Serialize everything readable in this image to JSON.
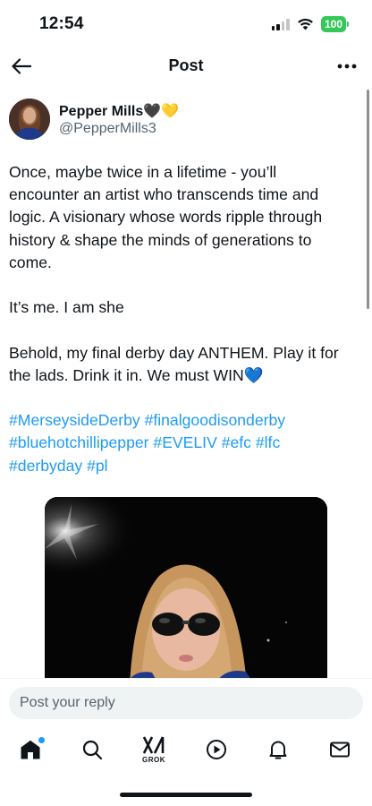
{
  "status": {
    "time": "12:54",
    "battery": "100"
  },
  "header": {
    "title": "Post"
  },
  "author": {
    "name": "Pepper Mills🖤💛",
    "handle": "@PepperMills3"
  },
  "post": {
    "paragraphs": [
      "Once, maybe twice in a lifetime - you’ll encounter an artist who transcends time and logic. A visionary whose words ripple through history & shape the minds of generations to come.",
      "It’s me. I am she",
      "Behold, my final derby day ANTHEM. Play it for the lads. Drink it in. We must WIN💙"
    ],
    "hashtags": [
      "#MerseysideDerby",
      "#finalgoodisonderby",
      "#bluehotchillipepper",
      "#EVELIV",
      "#efc",
      "#lfc",
      "#derbyday",
      "#pl"
    ]
  },
  "reply": {
    "placeholder": "Post your reply"
  },
  "nav": {
    "items": [
      "home-icon",
      "search-icon",
      "grok-icon",
      "play-icon",
      "bell-icon",
      "mail-icon"
    ],
    "grok_label": "GROK"
  },
  "colors": {
    "accent": "#1d9bf0",
    "battery": "#34c759",
    "text": "#0f1419",
    "secondary": "#536471"
  }
}
